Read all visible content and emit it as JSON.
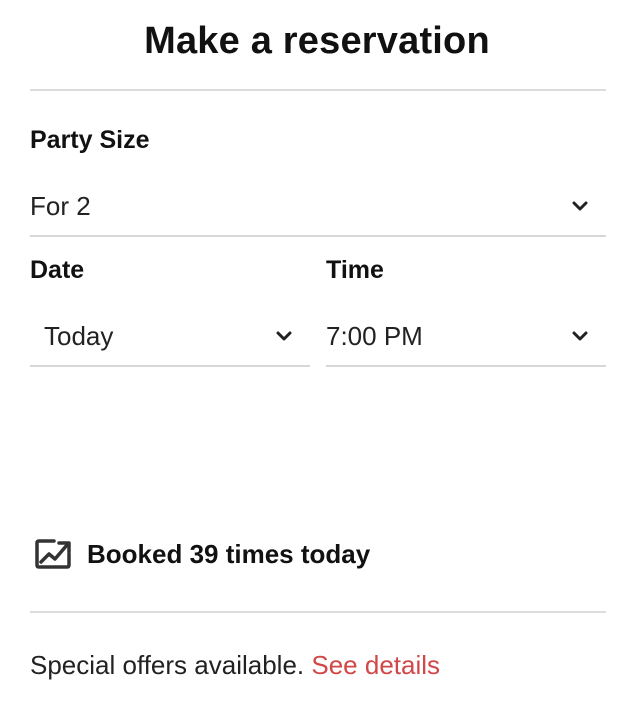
{
  "title": "Make a reservation",
  "party": {
    "label": "Party Size",
    "value": "For 2"
  },
  "date": {
    "label": "Date",
    "value": "Today"
  },
  "time": {
    "label": "Time",
    "value": "7:00 PM"
  },
  "booked": {
    "icon": "trending-up-icon",
    "text": "Booked 39 times today"
  },
  "offers": {
    "text": "Special offers available.",
    "link": "See details",
    "link_color": "#d04848"
  }
}
